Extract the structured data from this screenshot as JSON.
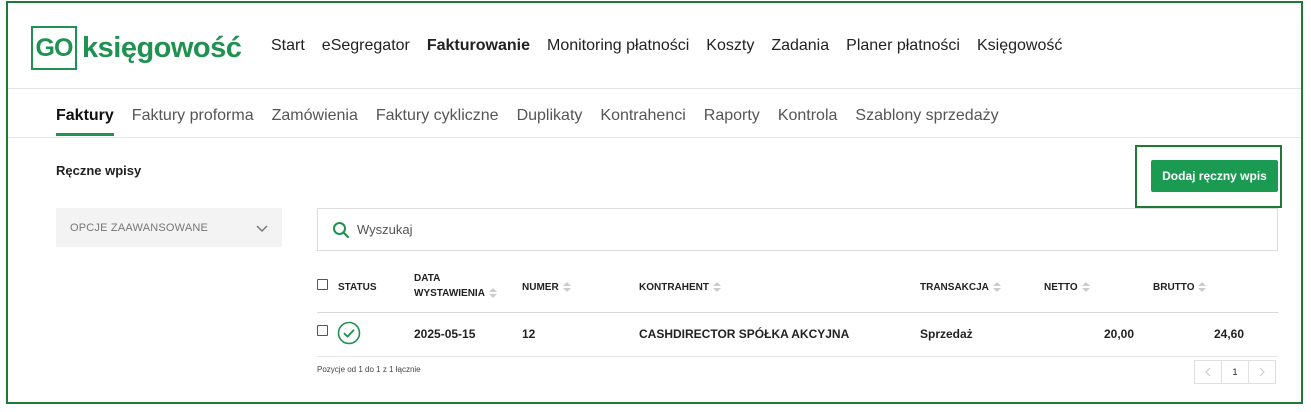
{
  "brand": {
    "box_text": "GO",
    "name": "księgowość",
    "color": "#1f9150"
  },
  "main_nav": {
    "items": [
      {
        "label": "Start"
      },
      {
        "label": "eSegregator"
      },
      {
        "label": "Fakturowanie"
      },
      {
        "label": "Monitoring płatności"
      },
      {
        "label": "Koszty"
      },
      {
        "label": "Zadania"
      },
      {
        "label": "Planer płatności"
      },
      {
        "label": "Księgowość"
      }
    ],
    "active": "Fakturowanie"
  },
  "sub_nav": {
    "items": [
      {
        "label": "Faktury"
      },
      {
        "label": "Faktury proforma"
      },
      {
        "label": "Zamówienia"
      },
      {
        "label": "Faktury cykliczne"
      },
      {
        "label": "Duplikaty"
      },
      {
        "label": "Kontrahenci"
      },
      {
        "label": "Raporty"
      },
      {
        "label": "Kontrola"
      },
      {
        "label": "Szablony sprzedaży"
      }
    ],
    "active": "Faktury"
  },
  "section_title": "Ręczne wpisy",
  "add_button": {
    "label": "Dodaj ręczny wpis",
    "color": "#1b9a52"
  },
  "advanced_options": {
    "label": "OPCJE ZAAWANSOWANE"
  },
  "search": {
    "placeholder": "Wyszukaj",
    "value": ""
  },
  "table": {
    "columns": {
      "status": "STATUS",
      "date_line1": "DATA",
      "date_line2": "WYSTAWIENIA",
      "number": "NUMER",
      "contractor": "KONTRAHENT",
      "transaction": "TRANSAKCJA",
      "net": "NETTO",
      "gross": "BRUTTO"
    },
    "rows": [
      {
        "status": "check-circle-icon",
        "date": "2025-05-15",
        "number": "12",
        "contractor": "CASHDIRECTOR SPÓŁKA AKCYJNA",
        "transaction": "Sprzedaż",
        "net": "20,00",
        "gross": "24,60"
      }
    ]
  },
  "footer": {
    "positions_text": "Pozycje od 1 do 1 z 1 łącznie"
  },
  "pagination": {
    "current_page": "1"
  }
}
